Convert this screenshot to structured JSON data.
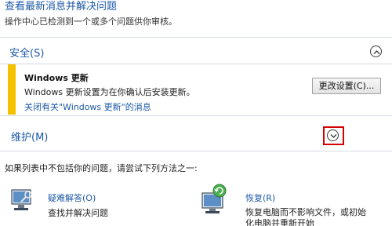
{
  "header": {
    "title": "查看最新消息并解决问题",
    "subtitle": "操作中心已检测到一个或多个问题供你审核。"
  },
  "security": {
    "title": "安全(S)",
    "alert": {
      "title": "Windows 更新",
      "message": "Windows 更新设置为在你确认后安装更新。",
      "link": "关闭有关\"Windows 更新\"的消息",
      "button": "更改设置(C)...",
      "accent_color": "#f4c100"
    }
  },
  "maintenance": {
    "title": "维护(M)"
  },
  "hint": "如果列表中不包括你的问题，请尝试下列方法之一:",
  "tiles": [
    {
      "link": "疑难解答(O)",
      "desc": "查找并解决问题",
      "icon": "troubleshoot-icon"
    },
    {
      "link": "恢复(R)",
      "desc_line1": "恢复电脑而不影响文件，或初始",
      "desc_line2": "化电脑并重新开始",
      "icon": "recovery-icon"
    }
  ],
  "colors": {
    "link": "#1e5aa8",
    "highlight": "#d40000"
  }
}
